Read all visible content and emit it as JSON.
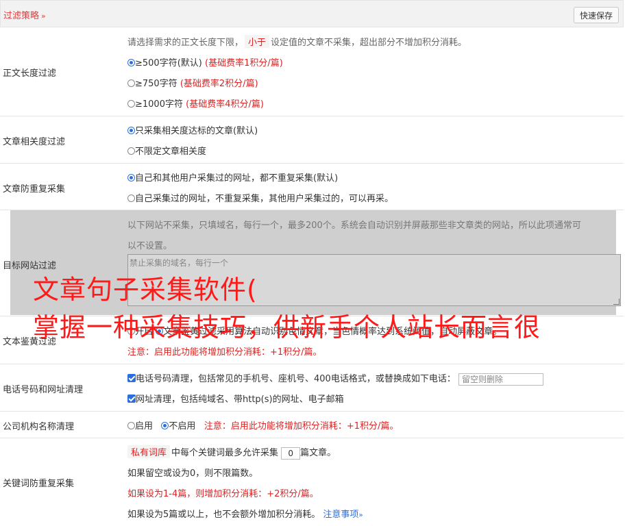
{
  "header": {
    "title": "过滤策略",
    "chevron": "»",
    "quick_save": "快速保存"
  },
  "length_filter": {
    "label": "正文长度过滤",
    "desc_before": "请选择需求的正文长度下限，",
    "desc_chip": "小于",
    "desc_after": "设定值的文章不采集，超出部分不增加积分消耗。",
    "options": [
      {
        "text": "≥500字符(默认)",
        "note": "(基础费率1积分/篇)",
        "selected": true
      },
      {
        "text": "≥750字符",
        "note": "(基础费率2积分/篇)",
        "selected": false
      },
      {
        "text": "≥1000字符",
        "note": "(基础费率4积分/篇)",
        "selected": false
      }
    ]
  },
  "relevance_filter": {
    "label": "文章相关度过滤",
    "options": [
      {
        "text": "只采集相关度达标的文章(默认)",
        "selected": true
      },
      {
        "text": "不限定文章相关度",
        "selected": false
      }
    ]
  },
  "dedupe_filter": {
    "label": "文章防重复采集",
    "options": [
      {
        "text": "自己和其他用户采集过的网址，都不重复采集(默认)",
        "selected": true
      },
      {
        "text": "自己采集过的网址，不重复采集，其他用户采集过的，可以再采。",
        "selected": false
      }
    ]
  },
  "site_filter": {
    "label": "目标网站过滤",
    "desc_line1": "以下网站不采集，只填域名，每行一个，最多200个。系统会自动识别并屏蔽那些非文章类的网站，所以此项通常可",
    "desc_line2": "以不设置。",
    "placeholder": "禁止采集的域名，每行一个"
  },
  "porn_filter": {
    "label": "文本鉴黄过滤",
    "opt_enable": "开启",
    "opt_detail": "文章鉴黄过滤采用算法自动识别色情文章，当色情概率达到系统阈值，自动屏蔽文章。",
    "note": "注意：启用此功能将增加积分消耗：+1积分/篇。"
  },
  "phone_url_clean": {
    "label": "电话号码和网址清理",
    "phone_text": "电话号码清理，包括常见的手机号、座机号、400电话格式，或替换成如下电话：",
    "phone_placeholder": "留空则删除",
    "url_text": "网址清理，包括纯域名、带http(s)的网址、电子邮箱"
  },
  "company_clean": {
    "label": "公司机构名称清理",
    "opt_enable": "启用",
    "opt_disable": "不启用",
    "note": "注意：启用此功能将增加积分消耗：+1积分/篇。"
  },
  "keyword_dedupe": {
    "label": "关键词防重复采集",
    "chip": "私有词库",
    "line1_before": "中每个关键词最多允许采集",
    "count_value": "0",
    "line1_after": "篇文章。",
    "line2": "如果留空或设为0，则不限篇数。",
    "line3": "如果设为1-4篇，则增加积分消耗：+2积分/篇。",
    "line4": "如果设为5篇或以上，也不会额外增加积分消耗。",
    "link": "注意事项",
    "link_chevron": "»"
  },
  "overlay": {
    "line1": "文章句子采集软件(",
    "line2": "掌握一种采集技巧，供新手个人站长而言很"
  }
}
